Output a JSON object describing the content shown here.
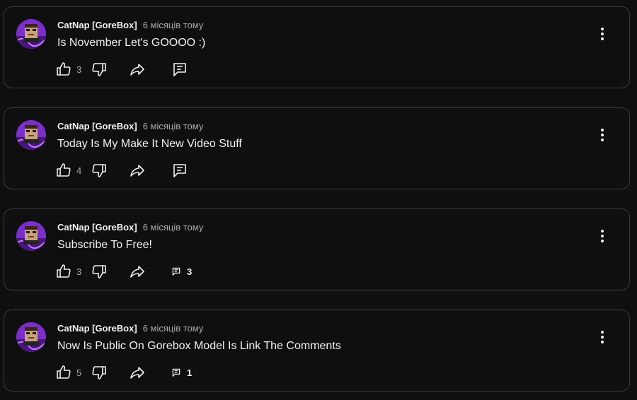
{
  "colors": {
    "background": "#0f0f0f",
    "card_border": "#3a3a3a",
    "text_primary": "#f1f1f1",
    "text_secondary": "#aaaaaa",
    "avatar_purple": "#7b2fc9"
  },
  "icons": {
    "like": "thumb-up-icon",
    "dislike": "thumb-down-icon",
    "share": "share-icon",
    "comment": "comment-icon",
    "menu": "more-vertical-icon",
    "avatar": "avatar-image"
  },
  "posts": [
    {
      "author": "CatNap [GoreBox]",
      "time": "6 місяців тому",
      "text": "Is November Let's GOOOO :)",
      "likes": "3",
      "comments": ""
    },
    {
      "author": "CatNap [GoreBox]",
      "time": "6 місяців тому",
      "text": "Today Is My Make It New Video Stuff",
      "likes": "4",
      "comments": ""
    },
    {
      "author": "CatNap [GoreBox]",
      "time": "6 місяців тому",
      "text": "Subscribe To Free!",
      "likes": "3",
      "comments": "3"
    },
    {
      "author": "CatNap [GoreBox]",
      "time": "6 місяців тому",
      "text": "Now Is Public On Gorebox Model Is Link The Comments",
      "likes": "5",
      "comments": "1"
    }
  ]
}
